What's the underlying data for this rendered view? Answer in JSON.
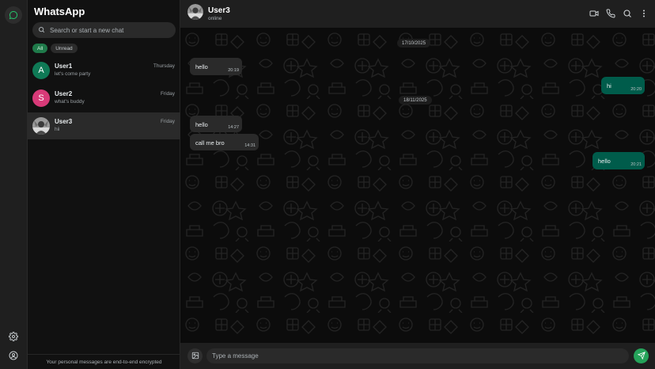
{
  "app": {
    "title": "WhatsApp"
  },
  "search": {
    "placeholder": "Search or start a new chat"
  },
  "filters": [
    {
      "label": "All",
      "active": true
    },
    {
      "label": "Unread",
      "active": false
    }
  ],
  "chats": [
    {
      "name": "User1",
      "last": "let's come party",
      "time": "Thursday",
      "avatar_letter": "A",
      "avatar_color": "#0f7a56",
      "selected": false
    },
    {
      "name": "User2",
      "last": "what's buddy",
      "time": "Friday",
      "avatar_letter": "S",
      "avatar_color": "#d83a78",
      "selected": false
    },
    {
      "name": "User3",
      "last": "hii",
      "time": "Friday",
      "avatar_letter": "",
      "avatar_color": "#8a8a8a",
      "selected": true
    }
  ],
  "footer": {
    "note": "Your personal messages are end-to-end encrypted"
  },
  "conversation": {
    "name": "User3",
    "status": "online",
    "dates": [
      "17/10/2025",
      "18/11/2025"
    ],
    "messages": [
      {
        "dir": "in",
        "text": "hello",
        "time": "20:19"
      },
      {
        "dir": "out",
        "text": "hi",
        "time": "20:20"
      },
      {
        "dir": "in",
        "text": "hello",
        "time": "14:27"
      },
      {
        "dir": "in",
        "text": "call me bro",
        "time": "14:31"
      },
      {
        "dir": "out",
        "text": "hello",
        "time": "20:21"
      }
    ]
  },
  "composer": {
    "placeholder": "Type a message"
  },
  "icons": {
    "rail_top": "chat-icon",
    "rail_bottom": [
      "settings-icon",
      "profile-icon"
    ],
    "header_actions": [
      "video-call-icon",
      "voice-call-icon",
      "search-icon",
      "menu-icon"
    ],
    "composer": [
      "image-attach-icon",
      "send-icon"
    ]
  },
  "colors": {
    "accent": "#25a35a",
    "outgoing_bubble": "#005c4b",
    "incoming_bubble": "#2a2a2a",
    "background": "#0c0c0c"
  }
}
